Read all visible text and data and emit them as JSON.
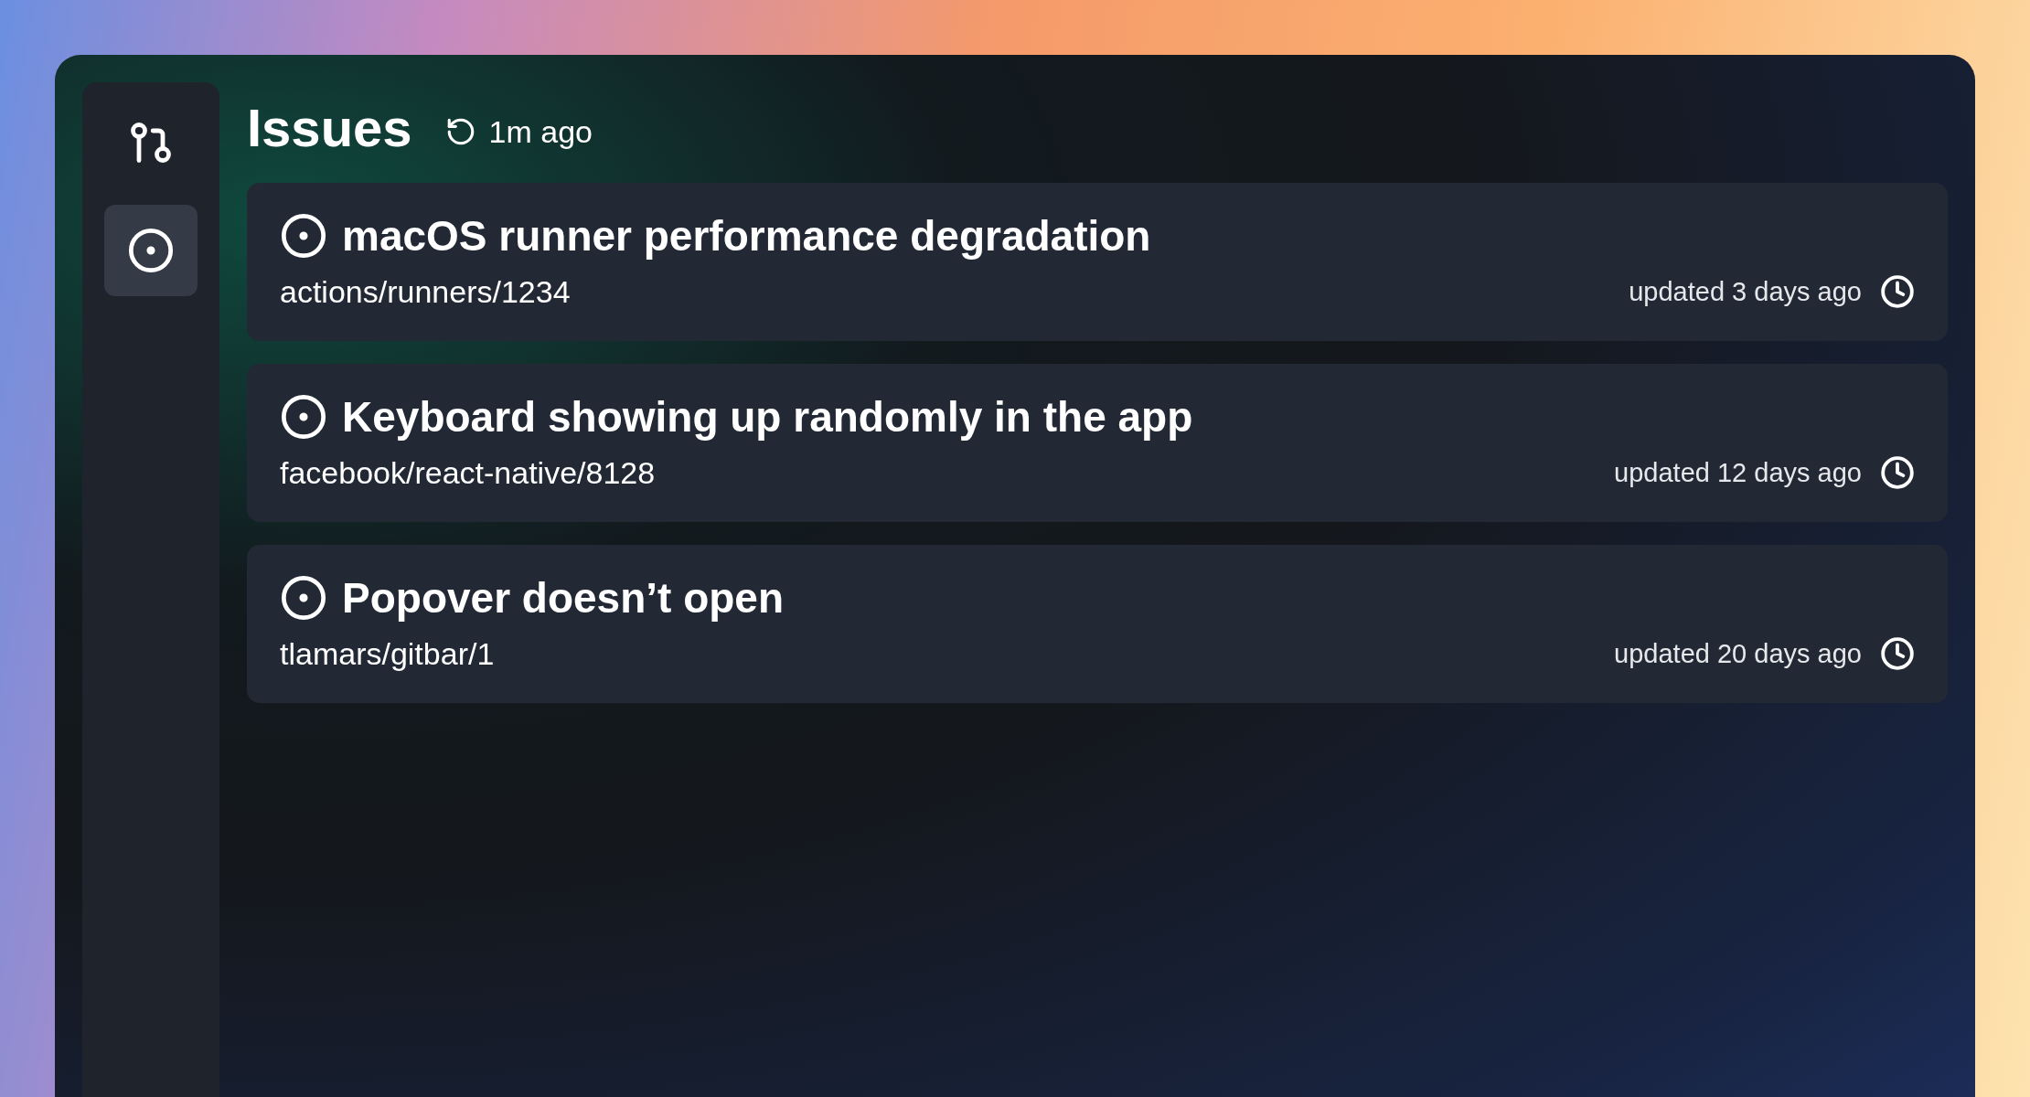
{
  "sidebar": {
    "items": [
      {
        "kind": "pull-requests",
        "selected": false
      },
      {
        "kind": "issues",
        "selected": true
      }
    ]
  },
  "header": {
    "title": "Issues",
    "refreshed": "1m ago"
  },
  "issues": [
    {
      "title": "macOS runner performance degradation",
      "repo": "actions/runners/1234",
      "updated": "updated 3 days ago"
    },
    {
      "title": "Keyboard showing up randomly in the app",
      "repo": "facebook/react-native/8128",
      "updated": "updated 12 days ago"
    },
    {
      "title": "Popover doesn’t open",
      "repo": "tlamars/gitbar/1",
      "updated": "updated 20 days ago"
    }
  ]
}
